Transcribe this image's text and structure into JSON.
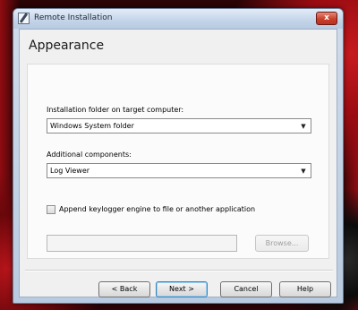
{
  "window": {
    "title": "Remote Installation",
    "close_label": "x"
  },
  "page": {
    "title": "Appearance"
  },
  "install_folder": {
    "label": "Installation folder on target computer:",
    "value": "Windows System folder"
  },
  "components": {
    "label": "Additional components:",
    "value": "Log Viewer"
  },
  "append": {
    "checked": false,
    "label": "Append keylogger engine to file or another application"
  },
  "path_field": {
    "value": ""
  },
  "browse_label": "Browse...",
  "buttons": {
    "back": "< Back",
    "next": "Next >",
    "cancel": "Cancel",
    "help": "Help"
  },
  "icons": {
    "dropdown": "chevron-down-icon",
    "app": "pencil-icon",
    "close": "close-icon"
  }
}
